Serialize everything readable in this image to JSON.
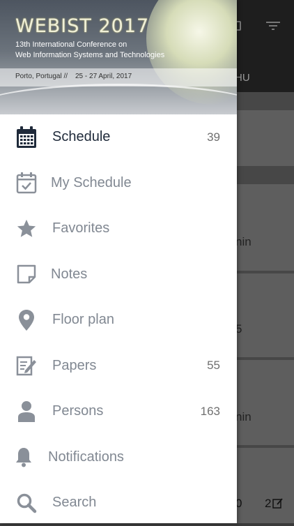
{
  "banner": {
    "title": "WEBIST 2017",
    "subtitle_line1": "13th International Conference on",
    "subtitle_line2": "Web Information Systems and Technologies",
    "location": "Porto, Portugal  //",
    "dates": "25 - 27 April, 2017"
  },
  "background": {
    "tab_text": "HU",
    "text_a": "nin",
    "text_b": "5",
    "text_c": "nin",
    "bottom_left": "0",
    "bottom_right": "2"
  },
  "menu": [
    {
      "label": "Schedule",
      "count": "39",
      "icon": "calendar-icon",
      "active": true
    },
    {
      "label": "My Schedule",
      "count": "",
      "icon": "calendar-check-icon"
    },
    {
      "label": "Favorites",
      "count": "",
      "icon": "star-icon"
    },
    {
      "label": "Notes",
      "count": "",
      "icon": "note-icon"
    },
    {
      "label": "Floor plan",
      "count": "",
      "icon": "location-pin-icon"
    },
    {
      "label": "Papers",
      "count": "55",
      "icon": "edit-document-icon"
    },
    {
      "label": "Persons",
      "count": "163",
      "icon": "person-icon"
    },
    {
      "label": "Notifications",
      "count": "",
      "icon": "bell-icon"
    },
    {
      "label": "Search",
      "count": "",
      "icon": "search-icon"
    }
  ],
  "colors": {
    "active_label": "#1f2a3a",
    "inactive_label": "#818892",
    "icon": "#8a9099",
    "active_icon": "#1f2a3a"
  }
}
